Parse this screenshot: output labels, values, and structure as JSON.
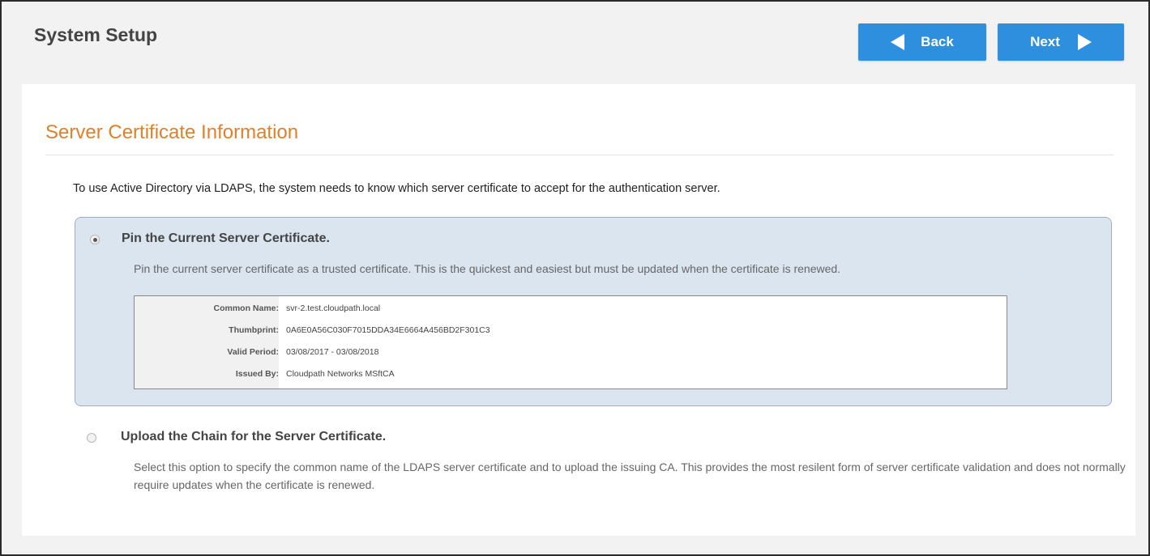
{
  "header": {
    "title": "System Setup",
    "back_label": "Back",
    "next_label": "Next",
    "button_color": "#2f8fdf"
  },
  "section": {
    "title": "Server Certificate Information",
    "title_color": "#e0802a",
    "intro": "To use Active Directory via LDAPS, the system needs to know which server certificate to accept for the authentication server."
  },
  "options": {
    "pin": {
      "title": "Pin the Current Server Certificate.",
      "description": "Pin the current server certificate as a trusted certificate. This is the quickest and easiest but must be updated when the certificate is renewed.",
      "selected": true,
      "certificate": [
        {
          "label": "Common Name:",
          "value": "svr-2.test.cloudpath.local"
        },
        {
          "label": "Thumbprint:",
          "value": "0A6E0A56C030F7015DDA34E6664A456BD2F301C3"
        },
        {
          "label": "Valid Period:",
          "value": "03/08/2017 - 03/08/2018"
        },
        {
          "label": "Issued By:",
          "value": "Cloudpath Networks MSftCA"
        }
      ]
    },
    "upload": {
      "title": "Upload the Chain for the Server Certificate.",
      "description": "Select this option to specify the common name of the LDAPS server certificate and to upload the issuing CA. This provides the most resilent form of server certificate validation and does not normally require updates when the certificate is renewed.",
      "selected": false
    }
  }
}
